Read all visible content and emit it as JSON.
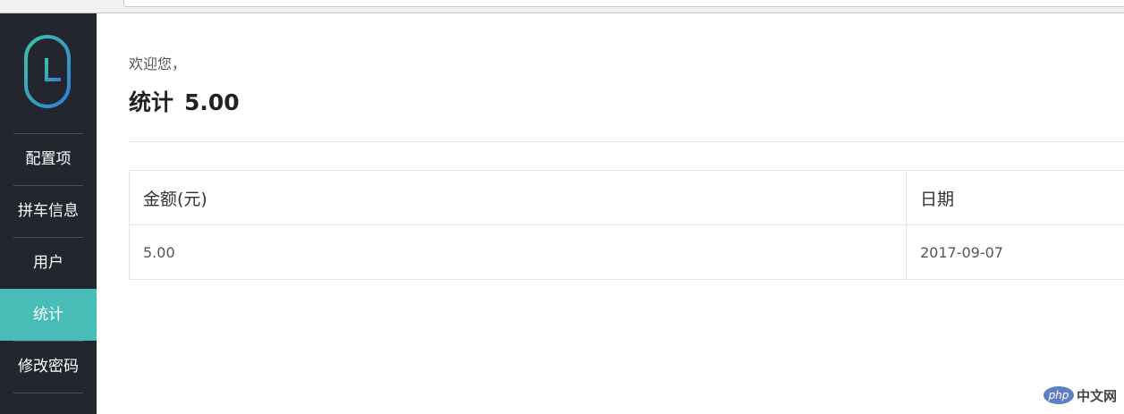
{
  "sidebar": {
    "logo": "logo-icon",
    "items": [
      {
        "label": "配置项",
        "active": false
      },
      {
        "label": "拼车信息",
        "active": false
      },
      {
        "label": "用户",
        "active": false
      },
      {
        "label": "统计",
        "active": true
      },
      {
        "label": "修改密码",
        "active": false
      }
    ]
  },
  "main": {
    "welcome": "欢迎您，",
    "title_label": "统计",
    "title_value": "5.00",
    "table": {
      "columns": [
        "金额(元)",
        "日期"
      ],
      "rows": [
        [
          "5.00",
          "2017-09-07"
        ]
      ]
    }
  },
  "watermark": {
    "badge": "php",
    "text": "中文网"
  },
  "colors": {
    "sidebar_bg": "#23262e",
    "active": "#48bdb7"
  }
}
